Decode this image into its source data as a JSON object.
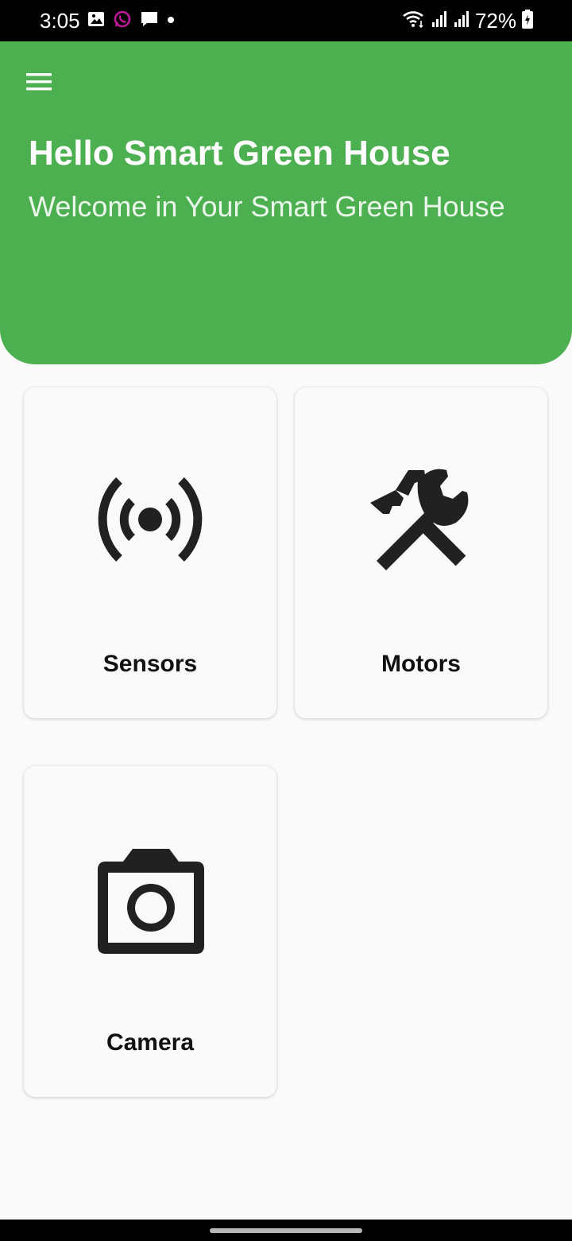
{
  "status_bar": {
    "time": "3:05",
    "battery_percent": "72%",
    "left_icons": [
      "gallery-icon",
      "whatsapp-icon",
      "message-icon",
      "dot-icon"
    ],
    "right_icons": [
      "wifi-icon",
      "signal-icon",
      "signal-icon",
      "battery-charging-icon"
    ],
    "whatsapp_color": "#c2199a"
  },
  "header": {
    "title": "Hello Smart Green House",
    "subtitle": "Welcome in Your Smart Green House",
    "background_color": "#4caf50",
    "menu_icon": "hamburger-menu-icon"
  },
  "cards": [
    {
      "label": "Sensors",
      "icon": "sensors-broadcast-icon"
    },
    {
      "label": "Motors",
      "icon": "tools-wrench-hammer-icon"
    },
    {
      "label": "Camera",
      "icon": "camera-icon"
    }
  ]
}
